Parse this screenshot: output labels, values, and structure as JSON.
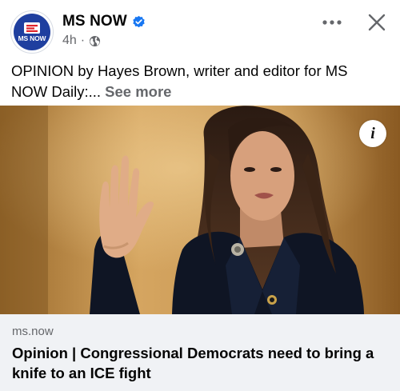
{
  "post": {
    "page_name": "MS NOW",
    "avatar_text": "MS NOW",
    "time": "4h",
    "separator": "·",
    "audience_icon": "globe-icon",
    "verified_icon": "verified-badge-icon",
    "more_icon": "more-options-icon",
    "close_icon": "close-icon",
    "caption": "OPINION by Hayes Brown, writer and editor for MS NOW Daily:...",
    "see_more": "See more"
  },
  "link_preview": {
    "info_icon": "info-icon",
    "info_glyph": "i",
    "domain": "ms.now",
    "headline": "Opinion | Congressional Democrats need to bring a knife to an ICE fight"
  },
  "colors": {
    "brand_blue": "#1f3f9f",
    "verified_blue": "#1877f2",
    "secondary_text": "#65676b",
    "link_box_bg": "#f0f2f5"
  }
}
